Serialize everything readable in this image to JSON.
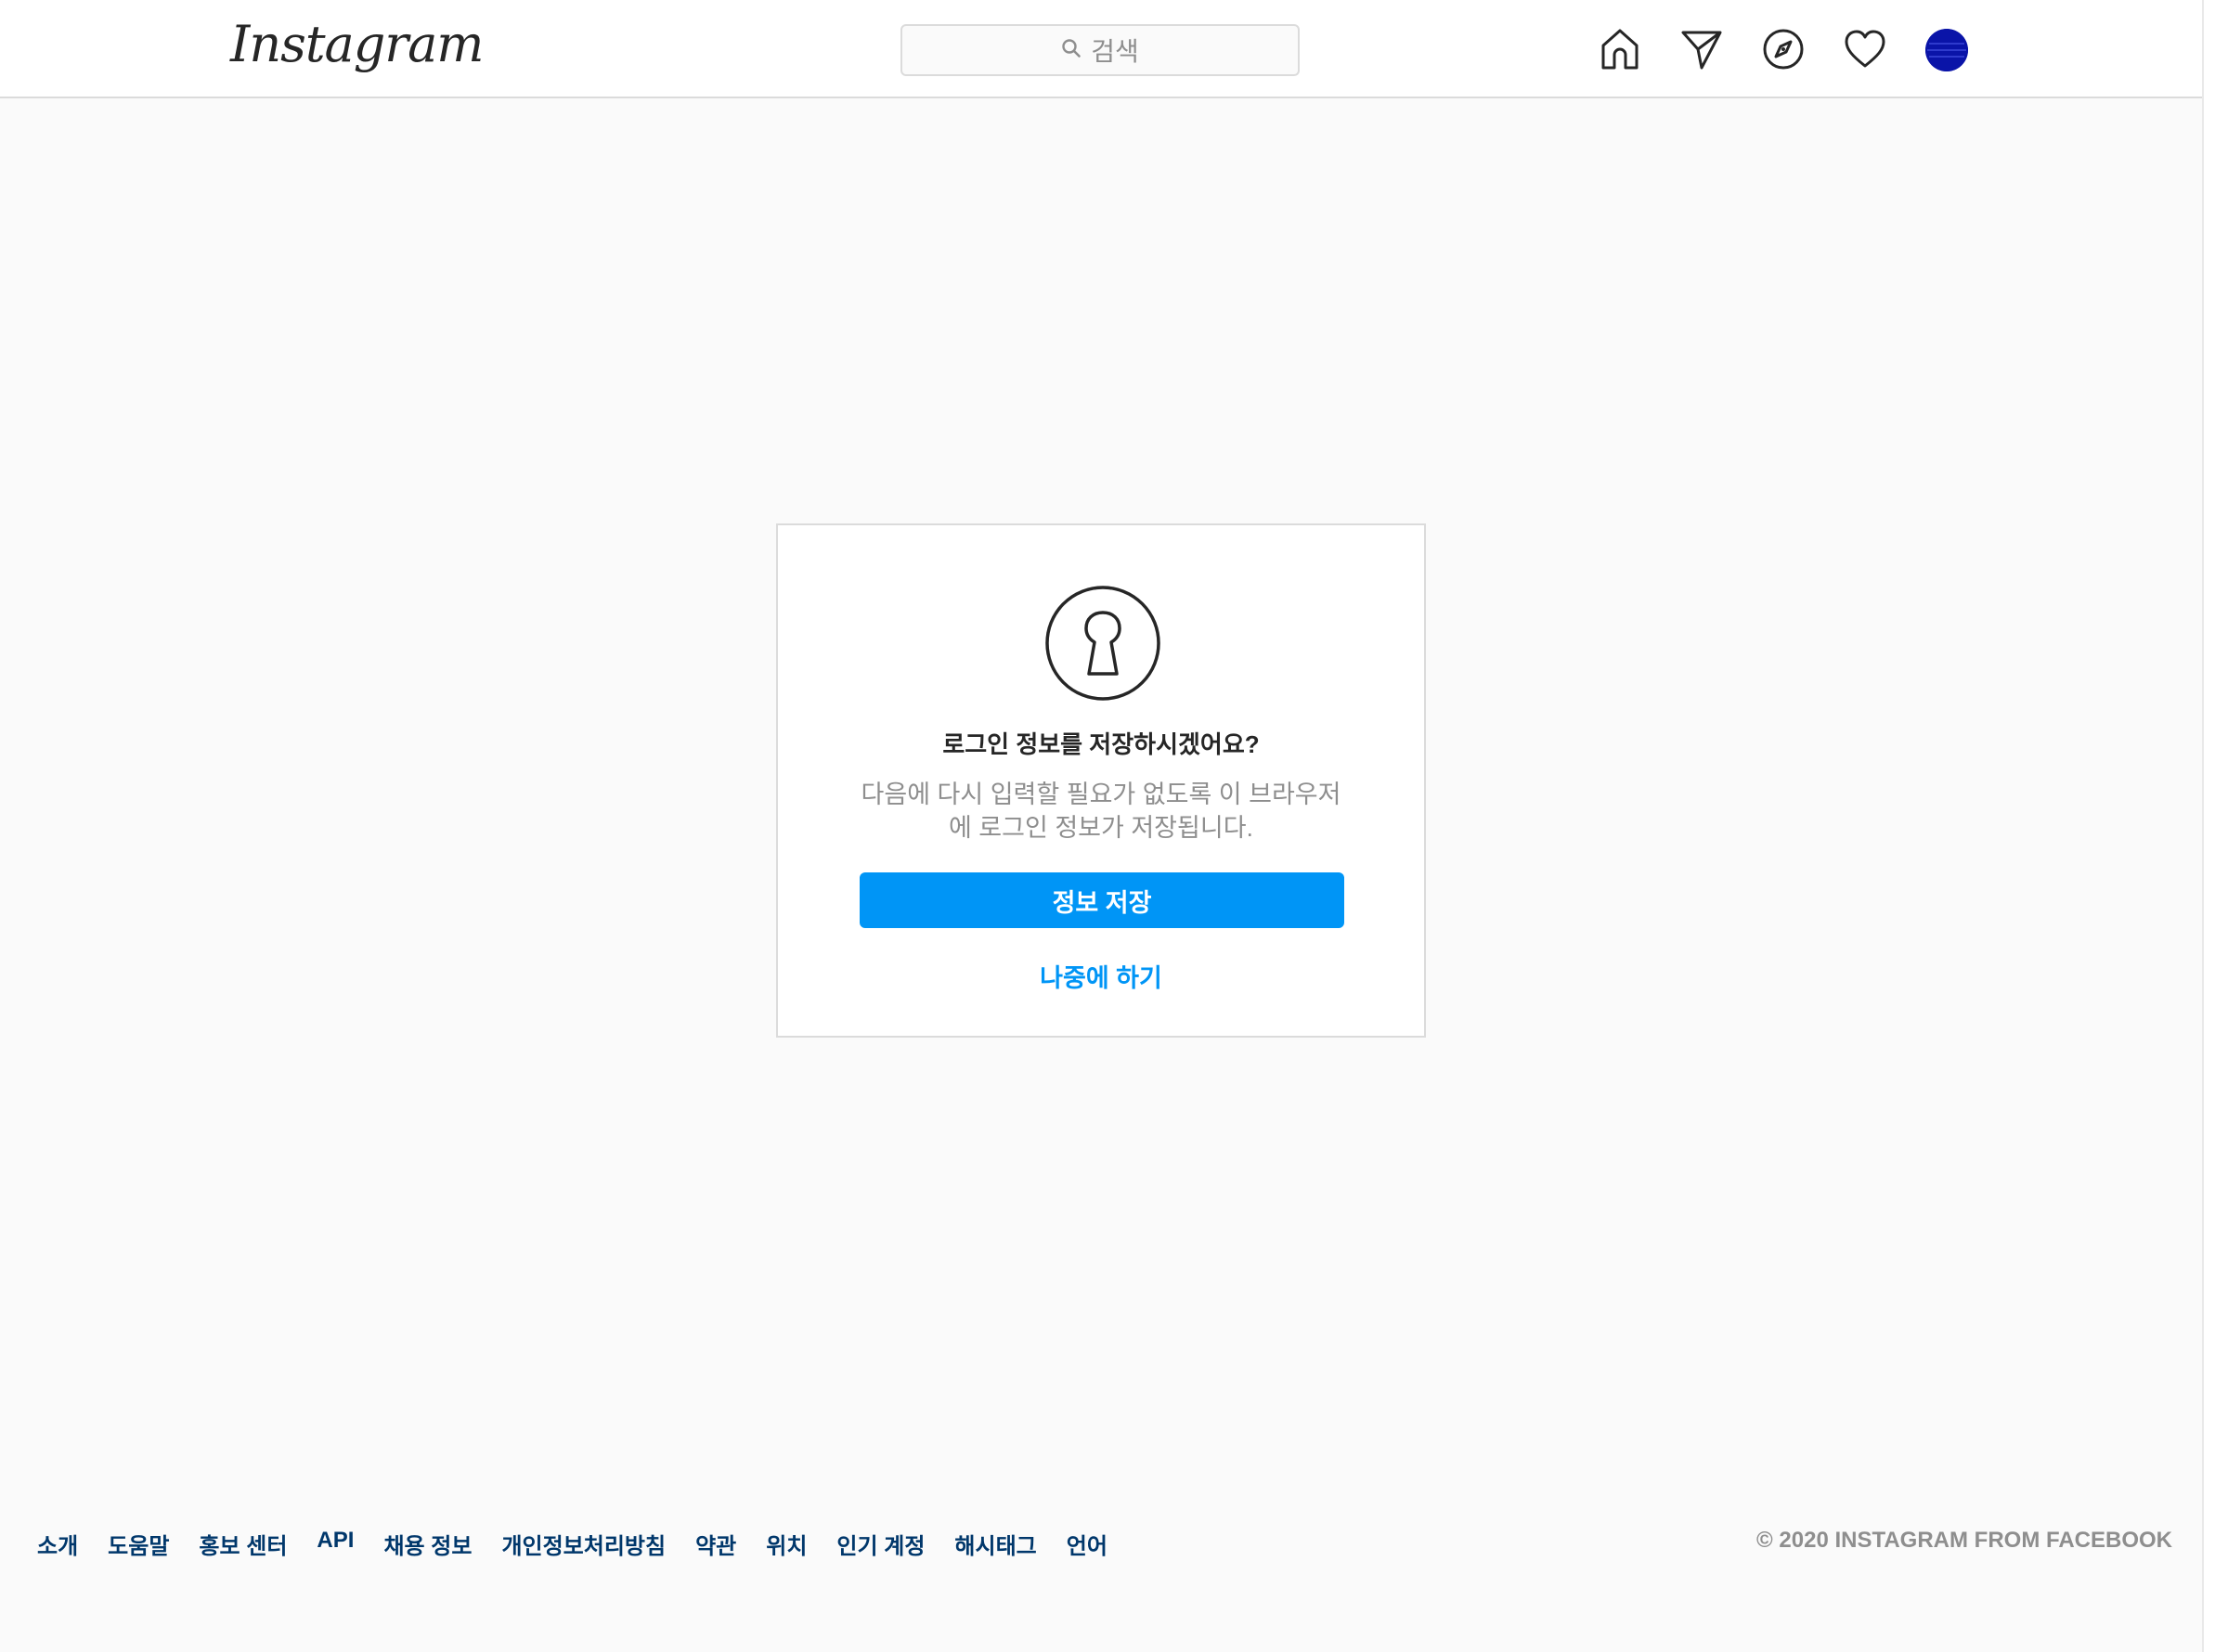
{
  "header": {
    "logo_text": "Instagram",
    "search_placeholder": "검색",
    "nav_icons": [
      "home-icon",
      "direct-message-icon",
      "explore-icon",
      "activity-heart-icon",
      "profile-avatar"
    ]
  },
  "dialog": {
    "icon": "keyhole-icon",
    "title": "로그인 정보를 저장하시겠어요?",
    "description": "다음에 다시 입력할 필요가 없도록 이 브라우저에 로그인 정보가 저장됩니다.",
    "save_button": "정보 저장",
    "later_button": "나중에 하기"
  },
  "footer": {
    "links": [
      "소개",
      "도움말",
      "홍보 센터",
      "API",
      "채용 정보",
      "개인정보처리방침",
      "약관",
      "위치",
      "인기 계정",
      "해시태그",
      "언어"
    ],
    "copyright": "© 2020 INSTAGRAM FROM FACEBOOK"
  },
  "colors": {
    "primary_blue": "#0095f6",
    "link_dark_blue": "#00376b",
    "muted_gray": "#8e8e8e",
    "background": "#fafafa",
    "border": "#dbdbdb",
    "avatar": "#0a14a8"
  }
}
